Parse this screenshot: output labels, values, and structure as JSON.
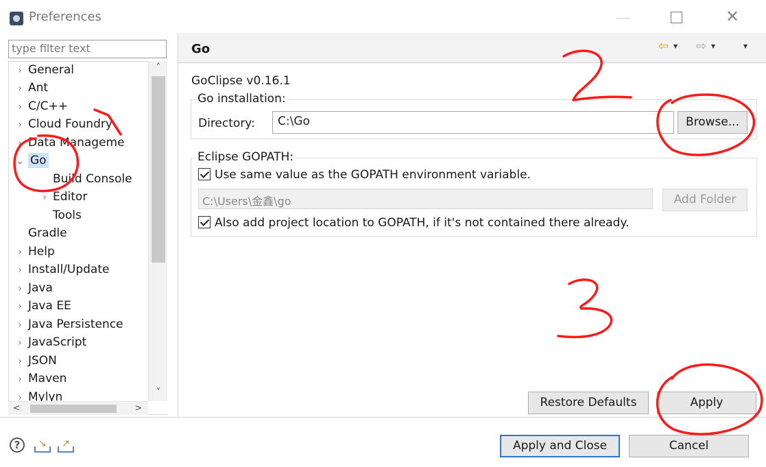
{
  "window": {
    "title": "Preferences",
    "min_icon": "—",
    "close_icon": "✕"
  },
  "filter": {
    "placeholder": "type filter text"
  },
  "tree": {
    "items": [
      {
        "label": "General",
        "expand": "›"
      },
      {
        "label": "Ant",
        "expand": "›"
      },
      {
        "label": "C/C++",
        "expand": "›"
      },
      {
        "label": "Cloud Foundry",
        "expand": "›"
      },
      {
        "label": "Data Manageme",
        "expand": "›"
      },
      {
        "label": "Go",
        "expand": "⌄"
      },
      {
        "label": "Build Console",
        "expand": ""
      },
      {
        "label": "Editor",
        "expand": "›"
      },
      {
        "label": "Tools",
        "expand": ""
      },
      {
        "label": "Gradle",
        "expand": ""
      },
      {
        "label": "Help",
        "expand": "›"
      },
      {
        "label": "Install/Update",
        "expand": "›"
      },
      {
        "label": "Java",
        "expand": "›"
      },
      {
        "label": "Java EE",
        "expand": "›"
      },
      {
        "label": "Java Persistence",
        "expand": "›"
      },
      {
        "label": "JavaScript",
        "expand": "›"
      },
      {
        "label": "JSON",
        "expand": "›"
      },
      {
        "label": "Maven",
        "expand": "›"
      },
      {
        "label": "Mylyn",
        "expand": "›"
      }
    ],
    "scroll_up": "˄",
    "scroll_down": "˅",
    "scroll_left": "<",
    "scroll_right": ">"
  },
  "page": {
    "title": "Go",
    "nav_back": "⇦",
    "nav_forward": "⇨",
    "nav_dropdown": "▾",
    "version": "GoClipse v0.16.1",
    "installation": {
      "title": "Go installation:",
      "directory_label": "Directory:",
      "directory_value": "C:\\Go",
      "browse_label": "Browse..."
    },
    "gopath": {
      "title": "Eclipse GOPATH:",
      "use_env_label": "Use same value as the GOPATH environment variable.",
      "use_env_checked": true,
      "path_value": "C:\\Users\\金鑫\\go",
      "add_folder_label": "Add Folder",
      "add_project_label": "Also add project location to GOPATH, if it's not contained there already.",
      "add_project_checked": true
    },
    "restore_defaults_label": "Restore Defaults",
    "apply_label": "Apply"
  },
  "footer": {
    "help_icon": "?",
    "apply_close_label": "Apply and Close",
    "cancel_label": "Cancel"
  },
  "annotations": {
    "stroke_color": "#ff1a1a",
    "numbers": [
      "1",
      "2",
      "3"
    ]
  }
}
